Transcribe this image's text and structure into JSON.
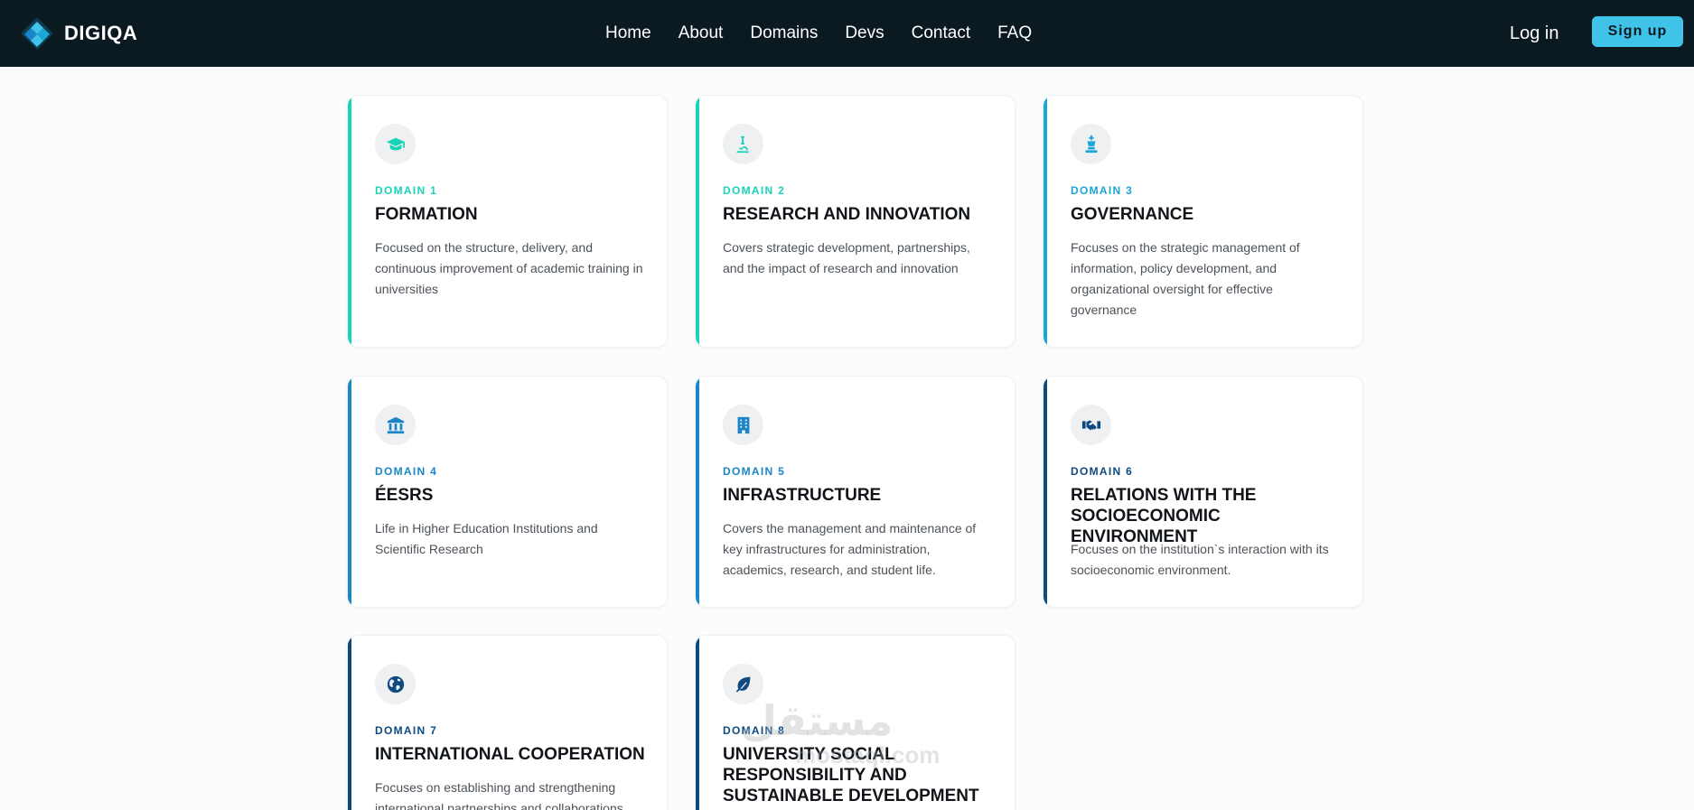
{
  "brand": {
    "name": "DIGIQA"
  },
  "nav": {
    "items": [
      "Home",
      "About",
      "Domains",
      "Devs",
      "Contact",
      "FAQ"
    ],
    "login": "Log in",
    "signup": "Sign up"
  },
  "colors": {
    "topbar": "#0b1a21",
    "signup": "#3fc3e9",
    "teal": "#19d3b8",
    "cyan": "#1aa6d6",
    "blue": "#1a86c8",
    "navy": "#0e4a80"
  },
  "domains": [
    {
      "label": "DOMAIN 1",
      "title": "FORMATION",
      "desc": "Focused on the structure, delivery, and continuous improvement of academic training in universities",
      "icon": "graduation-cap-icon",
      "accent": "#19d3b8"
    },
    {
      "label": "DOMAIN 2",
      "title": "RESEARCH AND INNOVATION",
      "desc": "Covers strategic development, partnerships, and the impact of research and innovation",
      "icon": "microscope-icon",
      "accent": "#19d3b8"
    },
    {
      "label": "DOMAIN 3",
      "title": "GOVERNANCE",
      "desc": "Focuses on the strategic management of information, policy development, and organizational oversight for effective governance",
      "icon": "chess-king-icon",
      "accent": "#1aa6d6"
    },
    {
      "label": "DOMAIN 4",
      "title": "ÉESRS",
      "desc": "Life in Higher Education Institutions and Scientific Research",
      "icon": "institution-icon",
      "accent": "#1a86c8"
    },
    {
      "label": "DOMAIN 5",
      "title": "INFRASTRUCTURE",
      "desc": "Covers the management and maintenance of key infrastructures for administration, academics, research, and student life.",
      "icon": "building-icon",
      "accent": "#1a86c8"
    },
    {
      "label": "DOMAIN 6",
      "title": "RELATIONS WITH THE SOCIOECONOMIC ENVIRONMENT",
      "desc": "Focuses on the institution`s interaction with its socioeconomic environment.",
      "icon": "handshake-icon",
      "accent": "#0e4a80"
    },
    {
      "label": "DOMAIN 7",
      "title": "INTERNATIONAL COOPERATION",
      "desc": "Focuses on establishing and strengthening international partnerships and collaborations",
      "icon": "globe-icon",
      "accent": "#0e4a80"
    },
    {
      "label": "DOMAIN 8",
      "title": "UNIVERSITY SOCIAL RESPONSIBILITY AND SUSTAINABLE DEVELOPMENT",
      "desc": "",
      "icon": "leaf-icon",
      "accent": "#0e4a80"
    }
  ],
  "watermark": {
    "text": "مستقل",
    "sub": "mostaql.com"
  }
}
